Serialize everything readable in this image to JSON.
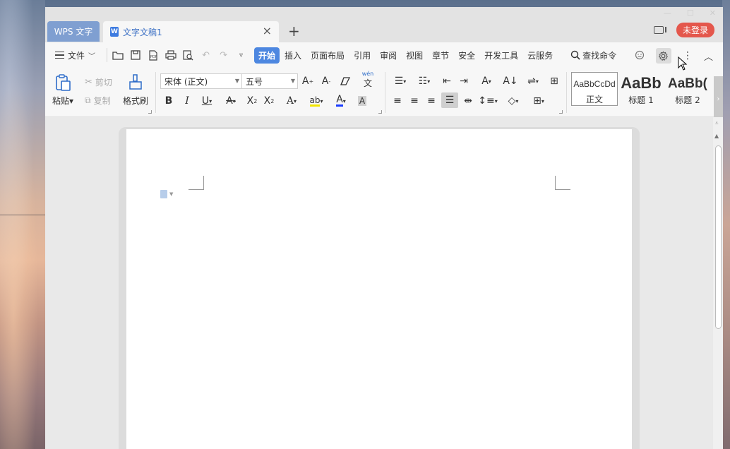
{
  "titlebar": {
    "app_tab": "WPS 文字",
    "doc_tab": "文字文稿1",
    "doc_tab_icon": "W",
    "add_tab": "+",
    "login": "未登录"
  },
  "menubar": {
    "file": "文件",
    "items": [
      "开始",
      "插入",
      "页面布局",
      "引用",
      "审阅",
      "视图",
      "章节",
      "安全",
      "开发工具",
      "云服务"
    ],
    "active": "开始",
    "search": "查找命令"
  },
  "ribbon": {
    "paste": "粘贴",
    "cut": "剪切",
    "copy": "复制",
    "format_painter": "格式刷",
    "font_name": "宋体 (正文)",
    "font_size": "五号",
    "phonetic_label": "wén",
    "styles": [
      {
        "preview": "AaBbCcDd",
        "label": "正文"
      },
      {
        "preview": "AaBb",
        "label": "标题 1"
      },
      {
        "preview": "AaBb(",
        "label": "标题 2"
      }
    ]
  },
  "colors": {
    "accent": "#4d87e0",
    "app_tab": "#7f9fd1",
    "login": "#e4574c",
    "highlight": "#f2e600",
    "font_color": "#1a3cff"
  }
}
